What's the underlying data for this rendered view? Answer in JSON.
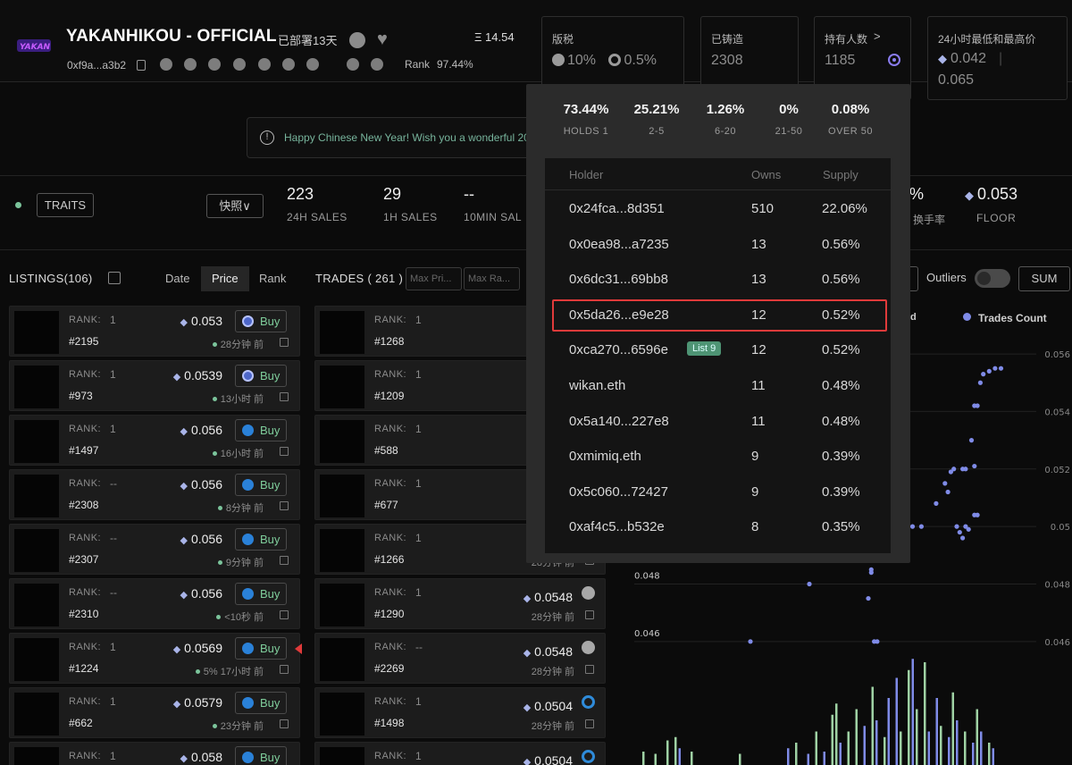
{
  "header": {
    "title": "YAKANHIKOU - OFFICIAL",
    "deployed": "已部署13天",
    "price_top": "Ξ 14.54",
    "address": "0xf9a...a3b2",
    "rank_label": "Rank",
    "rank_value": "97.44%"
  },
  "stat_boxes": {
    "royalty_label": "版税",
    "royalty_value_1": "10%",
    "royalty_value_2": "0.5%",
    "minted_label": "已铸造",
    "minted_value": "2308",
    "holders_label": "持有人数",
    "holders_value": "1185",
    "holders_arrow": ">",
    "range_label": "24小时最低和最高价",
    "range_low": "0.042",
    "range_high": "0.065"
  },
  "announcement": {
    "text": "Happy Chinese New Year! Wish you a wonderful 20"
  },
  "stats_row": {
    "traits": "TRAITS",
    "snapshot": "快照",
    "sales_24h_value": "223",
    "sales_24h_label": "24H SALES",
    "sales_1h_value": "29",
    "sales_1h_label": "1H SALES",
    "sales_10min_value": "--",
    "sales_10min_label": "10MIN SAL",
    "turnover_value": "%",
    "turnover_label": "换手率",
    "floor_value": "0.053",
    "floor_label": "FLOOR"
  },
  "listings": {
    "title": "LISTINGS(106)",
    "tabs": [
      "Date",
      "Price",
      "Rank"
    ],
    "active_tab": "Price",
    "rank_label": "RANK:",
    "buy_label": "Buy",
    "items": [
      {
        "rank": "1",
        "token": "#2195",
        "price": "0.053",
        "time": "28分钟 前",
        "market": "blur"
      },
      {
        "rank": "1",
        "token": "#973",
        "price": "0.0539",
        "time": "13小时 前",
        "market": "blur"
      },
      {
        "rank": "1",
        "token": "#1497",
        "price": "0.056",
        "time": "16小时 前",
        "market": "opensea"
      },
      {
        "rank": "--",
        "token": "#2308",
        "price": "0.056",
        "time": "8分钟 前",
        "market": "opensea"
      },
      {
        "rank": "--",
        "token": "#2307",
        "price": "0.056",
        "time": "9分钟 前",
        "market": "opensea"
      },
      {
        "rank": "--",
        "token": "#2310",
        "price": "0.056",
        "time": "<10秒 前",
        "market": "opensea"
      },
      {
        "rank": "1",
        "token": "#1224",
        "price": "0.0569",
        "time": "5%  17小时 前",
        "market": "opensea"
      },
      {
        "rank": "1",
        "token": "#662",
        "price": "0.0579",
        "time": "23分钟 前",
        "market": "opensea"
      },
      {
        "rank": "1",
        "token": "",
        "price": "0.058",
        "time": "",
        "market": "opensea"
      }
    ]
  },
  "trades": {
    "title": "TRADES ( 261 )",
    "max_price_placeholder": "Max Pri...",
    "max_rank_placeholder": "Max Ra...",
    "items": [
      {
        "rank": "1",
        "token": "#1268",
        "price": "",
        "time": ""
      },
      {
        "rank": "1",
        "token": "#1209",
        "price": "",
        "time": ""
      },
      {
        "rank": "1",
        "token": "#588",
        "price": "",
        "time": ""
      },
      {
        "rank": "1",
        "token": "#677",
        "price": "",
        "time": ""
      },
      {
        "rank": "1",
        "token": "#1266",
        "price": "",
        "time": "28分钟 前"
      },
      {
        "rank": "1",
        "token": "#1290",
        "price": "0.0548",
        "time": "28分钟 前",
        "market": "gray"
      },
      {
        "rank": "--",
        "token": "#2269",
        "price": "0.0548",
        "time": "28分钟 前",
        "market": "gray"
      },
      {
        "rank": "1",
        "token": "#1498",
        "price": "0.0504",
        "time": "28分钟 前",
        "market": "blue"
      },
      {
        "rank": "1",
        "token": "",
        "price": "0.0504",
        "time": "",
        "market": "blue"
      }
    ]
  },
  "chart_controls": {
    "outliers": "Outliers",
    "sum": "SUM",
    "legend_partial": "d",
    "legend_trades": "Trades Count"
  },
  "chart_data": {
    "type": "scatter",
    "series": [
      {
        "name": "Trades Count",
        "color": "#7f8be7"
      }
    ],
    "y_ticks": [
      "0.046",
      "0.048",
      "0.05",
      "0.052",
      "0.054",
      "0.056"
    ],
    "ylim": [
      0.045,
      0.0565
    ],
    "points": [
      [
        0.0,
        0.046
      ],
      [
        0.2,
        0.048
      ],
      [
        0.4,
        0.0475
      ],
      [
        0.42,
        0.046
      ],
      [
        0.43,
        0.046
      ],
      [
        0.41,
        0.0484
      ],
      [
        0.41,
        0.0485
      ],
      [
        0.5,
        0.05
      ],
      [
        0.52,
        0.05
      ],
      [
        0.55,
        0.05
      ],
      [
        0.58,
        0.05
      ],
      [
        0.63,
        0.0508
      ],
      [
        0.66,
        0.0515
      ],
      [
        0.67,
        0.0512
      ],
      [
        0.68,
        0.0519
      ],
      [
        0.69,
        0.052
      ],
      [
        0.7,
        0.05
      ],
      [
        0.71,
        0.0498
      ],
      [
        0.72,
        0.0496
      ],
      [
        0.73,
        0.05
      ],
      [
        0.74,
        0.0499
      ],
      [
        0.76,
        0.0504
      ],
      [
        0.77,
        0.0504
      ],
      [
        0.75,
        0.053
      ],
      [
        0.76,
        0.0542
      ],
      [
        0.77,
        0.0542
      ],
      [
        0.76,
        0.0521
      ],
      [
        0.78,
        0.055
      ],
      [
        0.79,
        0.0553
      ],
      [
        0.81,
        0.0554
      ],
      [
        0.83,
        0.0555
      ],
      [
        0.85,
        0.0555
      ],
      [
        0.72,
        0.052
      ],
      [
        0.73,
        0.052
      ]
    ],
    "bars": [
      {
        "x": 0.02,
        "v": 0.12,
        "s": 1
      },
      {
        "x": 0.05,
        "v": 0.1,
        "s": 1
      },
      {
        "x": 0.08,
        "v": 0.22,
        "s": 1
      },
      {
        "x": 0.1,
        "v": 0.25,
        "s": 1
      },
      {
        "x": 0.11,
        "v": 0.15,
        "s": 0
      },
      {
        "x": 0.14,
        "v": 0.12,
        "s": 1
      },
      {
        "x": 0.26,
        "v": 0.1,
        "s": 1
      },
      {
        "x": 0.38,
        "v": 0.15,
        "s": 0
      },
      {
        "x": 0.4,
        "v": 0.2,
        "s": 1
      },
      {
        "x": 0.43,
        "v": 0.1,
        "s": 0
      },
      {
        "x": 0.45,
        "v": 0.3,
        "s": 1
      },
      {
        "x": 0.47,
        "v": 0.12,
        "s": 0
      },
      {
        "x": 0.49,
        "v": 0.45,
        "s": 1
      },
      {
        "x": 0.5,
        "v": 0.55,
        "s": 1
      },
      {
        "x": 0.51,
        "v": 0.2,
        "s": 0
      },
      {
        "x": 0.53,
        "v": 0.3,
        "s": 1
      },
      {
        "x": 0.55,
        "v": 0.5,
        "s": 1
      },
      {
        "x": 0.57,
        "v": 0.35,
        "s": 0
      },
      {
        "x": 0.59,
        "v": 0.7,
        "s": 1
      },
      {
        "x": 0.6,
        "v": 0.4,
        "s": 0
      },
      {
        "x": 0.62,
        "v": 0.25,
        "s": 1
      },
      {
        "x": 0.63,
        "v": 0.6,
        "s": 0
      },
      {
        "x": 0.65,
        "v": 0.78,
        "s": 0
      },
      {
        "x": 0.66,
        "v": 0.3,
        "s": 1
      },
      {
        "x": 0.68,
        "v": 0.85,
        "s": 1
      },
      {
        "x": 0.69,
        "v": 0.95,
        "s": 0
      },
      {
        "x": 0.7,
        "v": 0.5,
        "s": 1
      },
      {
        "x": 0.72,
        "v": 0.92,
        "s": 1
      },
      {
        "x": 0.73,
        "v": 0.3,
        "s": 0
      },
      {
        "x": 0.75,
        "v": 0.6,
        "s": 0
      },
      {
        "x": 0.76,
        "v": 0.35,
        "s": 1
      },
      {
        "x": 0.78,
        "v": 0.25,
        "s": 0
      },
      {
        "x": 0.79,
        "v": 0.65,
        "s": 1
      },
      {
        "x": 0.8,
        "v": 0.4,
        "s": 0
      },
      {
        "x": 0.82,
        "v": 0.3,
        "s": 1
      },
      {
        "x": 0.84,
        "v": 0.2,
        "s": 0
      },
      {
        "x": 0.85,
        "v": 0.5,
        "s": 1
      },
      {
        "x": 0.86,
        "v": 0.3,
        "s": 0
      },
      {
        "x": 0.88,
        "v": 0.2,
        "s": 1
      },
      {
        "x": 0.89,
        "v": 0.15,
        "s": 0
      }
    ]
  },
  "holders_popup": {
    "distribution": [
      {
        "percent": "73.44%",
        "category": "HOLDS 1"
      },
      {
        "percent": "25.21%",
        "category": "2-5"
      },
      {
        "percent": "1.26%",
        "category": "6-20"
      },
      {
        "percent": "0%",
        "category": "21-50"
      },
      {
        "percent": "0.08%",
        "category": "OVER 50"
      }
    ],
    "columns": {
      "holder": "Holder",
      "owns": "Owns",
      "supply": "Supply"
    },
    "rows": [
      {
        "holder": "0x24fca...8d351",
        "owns": "510",
        "supply": "22.06%"
      },
      {
        "holder": "0x0ea98...a7235",
        "owns": "13",
        "supply": "0.56%"
      },
      {
        "holder": "0x6dc31...69bb8",
        "owns": "13",
        "supply": "0.56%"
      },
      {
        "holder": "0x5da26...e9e28",
        "owns": "12",
        "supply": "0.52%"
      },
      {
        "holder": "0xca270...6596e",
        "owns": "12",
        "supply": "0.52%",
        "badge": "List 9"
      },
      {
        "holder": "wikan.eth",
        "owns": "11",
        "supply": "0.48%"
      },
      {
        "holder": "0x5a140...227e8",
        "owns": "11",
        "supply": "0.48%"
      },
      {
        "holder": "0xmimiq.eth",
        "owns": "9",
        "supply": "0.39%"
      },
      {
        "holder": "0x5c060...72427",
        "owns": "9",
        "supply": "0.39%"
      },
      {
        "holder": "0xaf4c5...b532e",
        "owns": "8",
        "supply": "0.35%"
      }
    ],
    "highlighted_row": 3
  },
  "colors": {
    "accent_green": "#7fcd9b",
    "highlight_red": "#e03a3a",
    "scatter_blue": "#7f8be7",
    "bar_green": "#9fd2a4"
  }
}
